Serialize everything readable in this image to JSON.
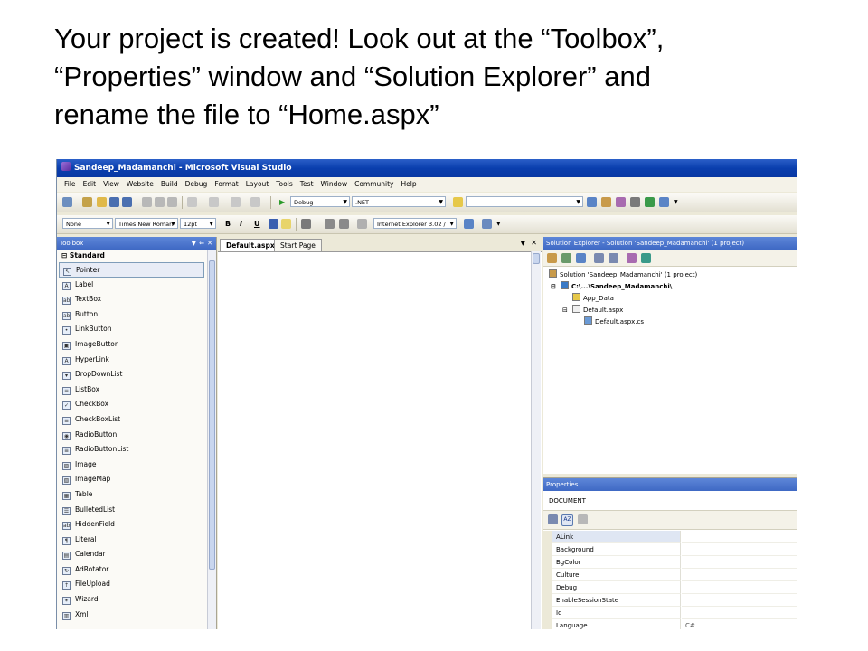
{
  "slide": {
    "line1": "Your project is created! Look out at the “Toolbox”,",
    "line2": "“Properties” window and “Solution Explorer” and",
    "line3": "rename the file to “Home.aspx”"
  },
  "window": {
    "title": "Sandeep_Madamanchi - Microsoft Visual Studio"
  },
  "menu": [
    "File",
    "Edit",
    "View",
    "Website",
    "Build",
    "Debug",
    "Format",
    "Layout",
    "Tools",
    "Test",
    "Window",
    "Community",
    "Help"
  ],
  "toolbar1": {
    "config": "Debug",
    "platform": ".NET"
  },
  "toolbar2": {
    "block_format": "None",
    "font": "Times New Roman",
    "size": "12pt",
    "bold": "B",
    "italic": "I",
    "underline": "U",
    "target_schema": "Internet Explorer 3.02 /"
  },
  "toolbox": {
    "title": "Toolbox",
    "group": "Standard",
    "items": [
      {
        "label": "Pointer",
        "icon": "pointer-icon",
        "glyph": "↖"
      },
      {
        "label": "Label",
        "icon": "label-icon",
        "glyph": "A"
      },
      {
        "label": "TextBox",
        "icon": "textbox-icon",
        "glyph": "ab"
      },
      {
        "label": "Button",
        "icon": "button-icon",
        "glyph": "ab"
      },
      {
        "label": "LinkButton",
        "icon": "linkbutton-icon",
        "glyph": "•"
      },
      {
        "label": "ImageButton",
        "icon": "imagebutton-icon",
        "glyph": "▣"
      },
      {
        "label": "HyperLink",
        "icon": "hyperlink-icon",
        "glyph": "A"
      },
      {
        "label": "DropDownList",
        "icon": "dropdownlist-icon",
        "glyph": "▾"
      },
      {
        "label": "ListBox",
        "icon": "listbox-icon",
        "glyph": "≡"
      },
      {
        "label": "CheckBox",
        "icon": "checkbox-icon",
        "glyph": "✓"
      },
      {
        "label": "CheckBoxList",
        "icon": "checkboxlist-icon",
        "glyph": "≡"
      },
      {
        "label": "RadioButton",
        "icon": "radiobutton-icon",
        "glyph": "◉"
      },
      {
        "label": "RadioButtonList",
        "icon": "radiobuttonlist-icon",
        "glyph": "≡"
      },
      {
        "label": "Image",
        "icon": "image-icon",
        "glyph": "▨"
      },
      {
        "label": "ImageMap",
        "icon": "imagemap-icon",
        "glyph": "▧"
      },
      {
        "label": "Table",
        "icon": "table-icon",
        "glyph": "▦"
      },
      {
        "label": "BulletedList",
        "icon": "bulletedlist-icon",
        "glyph": "☰"
      },
      {
        "label": "HiddenField",
        "icon": "hiddenfield-icon",
        "glyph": "ab"
      },
      {
        "label": "Literal",
        "icon": "literal-icon",
        "glyph": "¶"
      },
      {
        "label": "Calendar",
        "icon": "calendar-icon",
        "glyph": "▤"
      },
      {
        "label": "AdRotator",
        "icon": "adrotator-icon",
        "glyph": "↻"
      },
      {
        "label": "FileUpload",
        "icon": "fileupload-icon",
        "glyph": "↑"
      },
      {
        "label": "Wizard",
        "icon": "wizard-icon",
        "glyph": "✴"
      },
      {
        "label": "Xml",
        "icon": "xml-icon",
        "glyph": "▥"
      }
    ]
  },
  "editor": {
    "tabs": [
      "Default.aspx",
      "Start Page"
    ]
  },
  "solution_explorer": {
    "title": "Solution Explorer - Solution 'Sandeep_Madamanchi' (1 project)",
    "nodes": [
      {
        "label": "Solution 'Sandeep_Madamanchi' (1 project)",
        "level": 0,
        "icon": "solution-icon"
      },
      {
        "label": "C:\\...\\Sandeep_Madamanchi\\",
        "level": 1,
        "icon": "website-icon",
        "bold": true
      },
      {
        "label": "App_Data",
        "level": 2,
        "icon": "folder-icon"
      },
      {
        "label": "Default.aspx",
        "level": 2,
        "icon": "aspx-file-icon"
      },
      {
        "label": "Default.aspx.cs",
        "level": 3,
        "icon": "cs-file-icon"
      }
    ]
  },
  "properties": {
    "title": "Properties",
    "object": "DOCUMENT",
    "rows": [
      {
        "name": "ALink",
        "value": ""
      },
      {
        "name": "Background",
        "value": ""
      },
      {
        "name": "BgColor",
        "value": ""
      },
      {
        "name": "Culture",
        "value": ""
      },
      {
        "name": "Debug",
        "value": ""
      },
      {
        "name": "EnableSessionState",
        "value": ""
      },
      {
        "name": "Id",
        "value": ""
      },
      {
        "name": "Language",
        "value": "C#"
      }
    ]
  },
  "colors": {
    "titlebar": "#0a3fae",
    "panel_header": "#3f69c4",
    "chrome": "#ece9d8"
  }
}
